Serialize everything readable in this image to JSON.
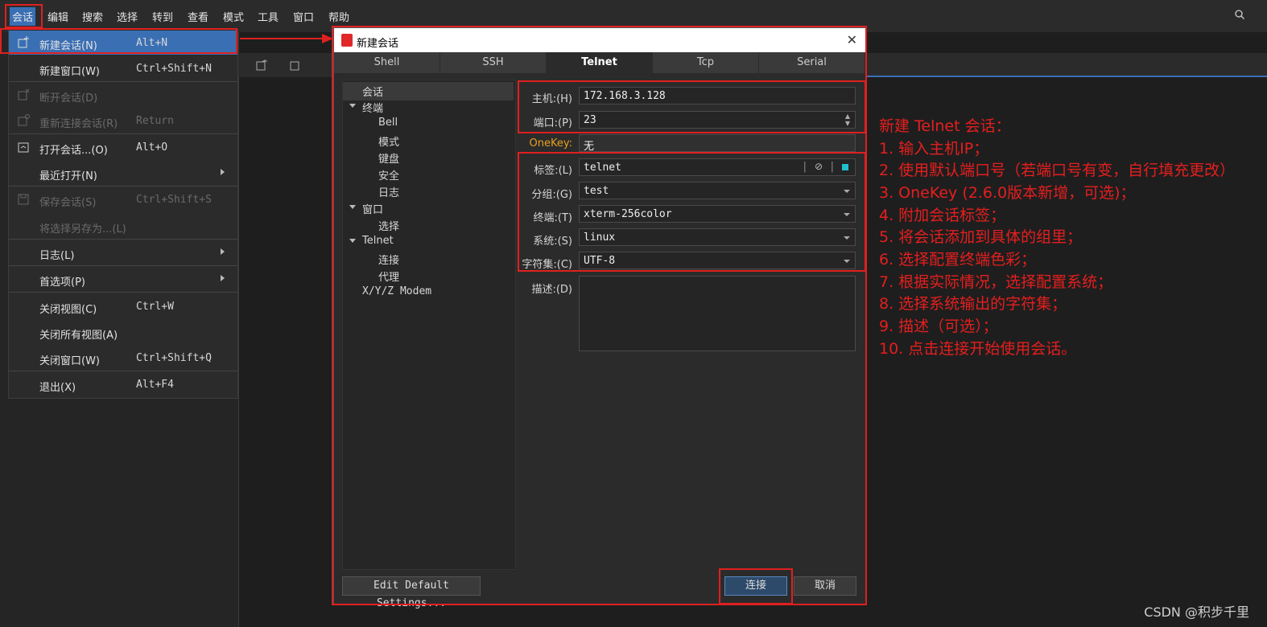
{
  "menubar": {
    "items": [
      "会话",
      "编辑",
      "搜索",
      "选择",
      "转到",
      "查看",
      "模式",
      "工具",
      "窗口",
      "帮助"
    ]
  },
  "session_menu": {
    "items": [
      {
        "label": "新建会话(N)",
        "shortcut": "Alt+N",
        "disabled": false,
        "highlighted": true
      },
      {
        "label": "新建窗口(W)",
        "shortcut": "Ctrl+Shift+N",
        "disabled": false
      },
      {
        "label": "断开会话(D)",
        "shortcut": "",
        "disabled": true
      },
      {
        "label": "重新连接会话(R)",
        "shortcut": "Return",
        "disabled": true
      },
      {
        "label": "打开会话...(O)",
        "shortcut": "Alt+O",
        "disabled": false
      },
      {
        "label": "最近打开(N)",
        "shortcut": "",
        "disabled": false,
        "submenu": true
      },
      {
        "label": "保存会话(S)",
        "shortcut": "Ctrl+Shift+S",
        "disabled": true
      },
      {
        "label": "将选择另存为...(L)",
        "shortcut": "",
        "disabled": true
      },
      {
        "label": "日志(L)",
        "shortcut": "",
        "disabled": false,
        "submenu": true
      },
      {
        "label": "首选项(P)",
        "shortcut": "",
        "disabled": false,
        "submenu": true
      },
      {
        "label": "关闭视图(C)",
        "shortcut": "Ctrl+W",
        "disabled": false
      },
      {
        "label": "关闭所有视图(A)",
        "shortcut": "",
        "disabled": false
      },
      {
        "label": "关闭窗口(W)",
        "shortcut": "Ctrl+Shift+Q",
        "disabled": false
      },
      {
        "label": "退出(X)",
        "shortcut": "Alt+F4",
        "disabled": false
      }
    ]
  },
  "dialog": {
    "title": "新建会话",
    "tabs": [
      "Shell",
      "SSH",
      "Telnet",
      "Tcp",
      "Serial"
    ],
    "selected_tab": "Telnet",
    "tree": [
      "会话",
      "终端",
      "Bell",
      "模式",
      "键盘",
      "安全",
      "日志",
      "窗口",
      "选择",
      "Telnet",
      "连接",
      "代理",
      "X/Y/Z Modem"
    ],
    "fields": {
      "host_label": "主机:(H)",
      "host_value": "172.168.3.128",
      "port_label": "端口:(P)",
      "port_value": "23",
      "onekey_label": "OneKey:",
      "onekey_value": "无",
      "tag_label": "标签:(L)",
      "tag_value": "telnet",
      "group_label": "分组:(G)",
      "group_value": "test",
      "terminal_label": "终端:(T)",
      "terminal_value": "xterm-256color",
      "system_label": "系统:(S)",
      "system_value": "linux",
      "charset_label": "字符集:(C)",
      "charset_value": "UTF-8",
      "desc_label": "描述:(D)"
    },
    "edit_default_button": "Edit Default Settings...",
    "connect_button": "连接",
    "cancel_button": "取消"
  },
  "notes": [
    "新建 Telnet 会话：",
    "1. 输入主机IP；",
    "2. 使用默认端口号（若端口号有变，自行填充更改）",
    "3. OneKey (2.6.0版本新增，可选)；",
    "4. 附加会话标签；",
    "5. 将会话添加到具体的组里；",
    "6. 选择配置终端色彩；",
    "7. 根据实际情况，选择配置系统；",
    "8. 选择系统输出的字符集；",
    "9. 描述（可选）；",
    "10. 点击连接开始使用会话。"
  ],
  "watermark": "CSDN @积步千里",
  "colors": {
    "accent": "#3a6fb4",
    "annotation": "#e02020",
    "onekey": "#e8a020"
  }
}
